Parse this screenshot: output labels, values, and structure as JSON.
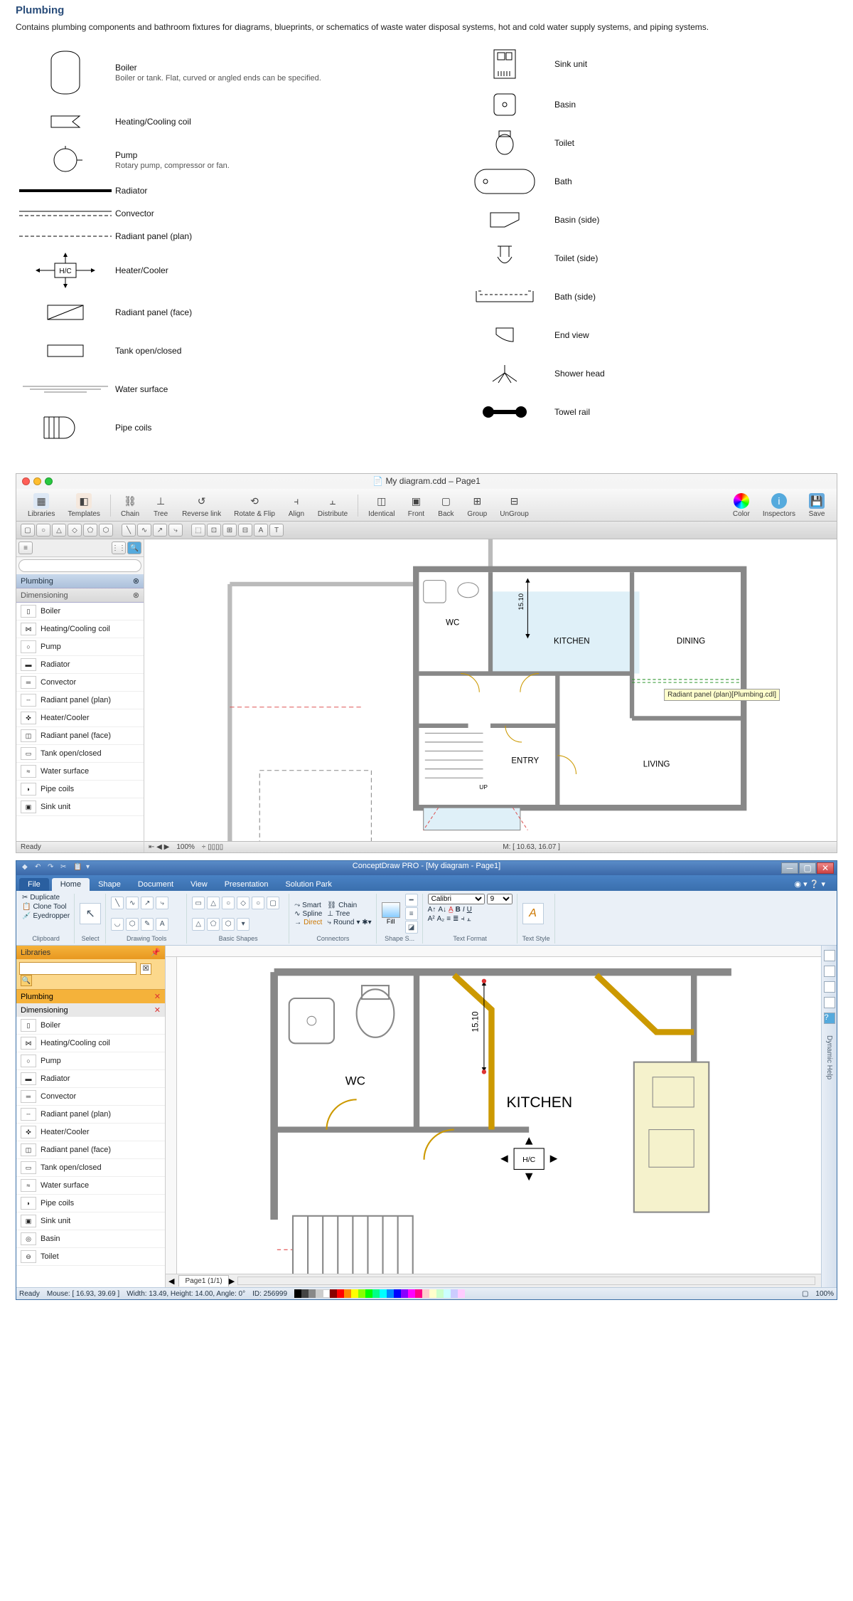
{
  "header": {
    "title": "Plumbing",
    "desc": "Contains plumbing components and bathroom fixtures for diagrams, blueprints, or schematics of waste water disposal systems, hot and cold water supply systems, and piping systems."
  },
  "symbols_left": [
    {
      "label": "Boiler",
      "sub": "Boiler or tank. Flat, curved or angled ends can be specified."
    },
    {
      "label": "Heating/Cooling coil",
      "sub": ""
    },
    {
      "label": "Pump",
      "sub": "Rotary pump, compressor or fan."
    },
    {
      "label": "Radiator",
      "sub": ""
    },
    {
      "label": "Convector",
      "sub": ""
    },
    {
      "label": "Radiant panel (plan)",
      "sub": ""
    },
    {
      "label": "Heater/Cooler",
      "sub": ""
    },
    {
      "label": "Radiant panel (face)",
      "sub": ""
    },
    {
      "label": "Tank open/closed",
      "sub": ""
    },
    {
      "label": "Water surface",
      "sub": ""
    },
    {
      "label": "Pipe coils",
      "sub": ""
    }
  ],
  "symbols_right": [
    {
      "label": "Sink unit"
    },
    {
      "label": "Basin"
    },
    {
      "label": "Toilet"
    },
    {
      "label": "Bath"
    },
    {
      "label": "Basin (side)"
    },
    {
      "label": "Toilet (side)"
    },
    {
      "label": "Bath (side)"
    },
    {
      "label": "End view"
    },
    {
      "label": "Shower head"
    },
    {
      "label": "Towel rail"
    }
  ],
  "hc": "H/C",
  "mac": {
    "title": "My diagram.cdd – Page1",
    "toolbar": [
      "Libraries",
      "Templates",
      "Chain",
      "Tree",
      "Reverse link",
      "Rotate & Flip",
      "Align",
      "Distribute",
      "Identical",
      "Front",
      "Back",
      "Group",
      "UnGroup",
      "Color",
      "Inspectors",
      "Save"
    ],
    "sidebar": {
      "plumbing": "Plumbing",
      "dimensioning": "Dimensioning",
      "items": [
        "Boiler",
        "Heating/Cooling coil",
        "Pump",
        "Radiator",
        "Convector",
        "Radiant panel (plan)",
        "Heater/Cooler",
        "Radiant panel (face)",
        "Tank open/closed",
        "Water surface",
        "Pipe coils",
        "Sink unit"
      ]
    },
    "zoom": "100%",
    "status_ready": "Ready",
    "status_mouse": "M: [ 10.63, 16.07 ]",
    "tooltip": "Radiant panel (plan)[Plumbing.cdl]",
    "rooms": {
      "wc": "WC",
      "kitchen": "KITCHEN",
      "dining": "DINING",
      "entry": "ENTRY",
      "living": "LIVING",
      "up": "UP"
    },
    "dim": "15.10"
  },
  "win": {
    "title": "ConceptDraw PRO - [My diagram - Page1]",
    "tabs": [
      "File",
      "Home",
      "Shape",
      "Document",
      "View",
      "Presentation",
      "Solution Park"
    ],
    "ribbon": {
      "clipboard": {
        "title": "Clipboard",
        "duplicate": "Duplicate",
        "clone": "Clone Tool",
        "eyedropper": "Eyedropper"
      },
      "select": "Select",
      "drawing": {
        "title": "Drawing Tools"
      },
      "shapes": {
        "title": "Basic Shapes"
      },
      "connectors": {
        "title": "Connectors",
        "smart": "Smart",
        "spline": "Spline",
        "direct": "Direct",
        "round": "Round",
        "chain": "Chain",
        "tree": "Tree"
      },
      "fill": "Fill",
      "shapestyle": "Shape S...",
      "font": "Calibri",
      "fontsize": "9",
      "textformat": "Text Format",
      "textstyle": "Text Style"
    },
    "sidebar": {
      "libraries": "Libraries",
      "plumbing": "Plumbing",
      "dimensioning": "Dimensioning",
      "items": [
        "Boiler",
        "Heating/Cooling coil",
        "Pump",
        "Radiator",
        "Convector",
        "Radiant panel (plan)",
        "Heater/Cooler",
        "Radiant panel (face)",
        "Tank open/closed",
        "Water surface",
        "Pipe coils",
        "Sink unit",
        "Basin",
        "Toilet"
      ]
    },
    "rooms": {
      "wc": "WC",
      "kitchen": "KITCHEN",
      "hc": "H/C"
    },
    "dim": "15.10",
    "page_tab": "Page1 (1/1)",
    "status": {
      "ready": "Ready",
      "mouse": "Mouse: [ 16.93, 39.69 ]",
      "dims": "Width: 13.49,  Height: 14.00,  Angle: 0°",
      "id": "ID: 256999",
      "zoom": "100%"
    },
    "dyn_help": "Dynamic Help"
  }
}
